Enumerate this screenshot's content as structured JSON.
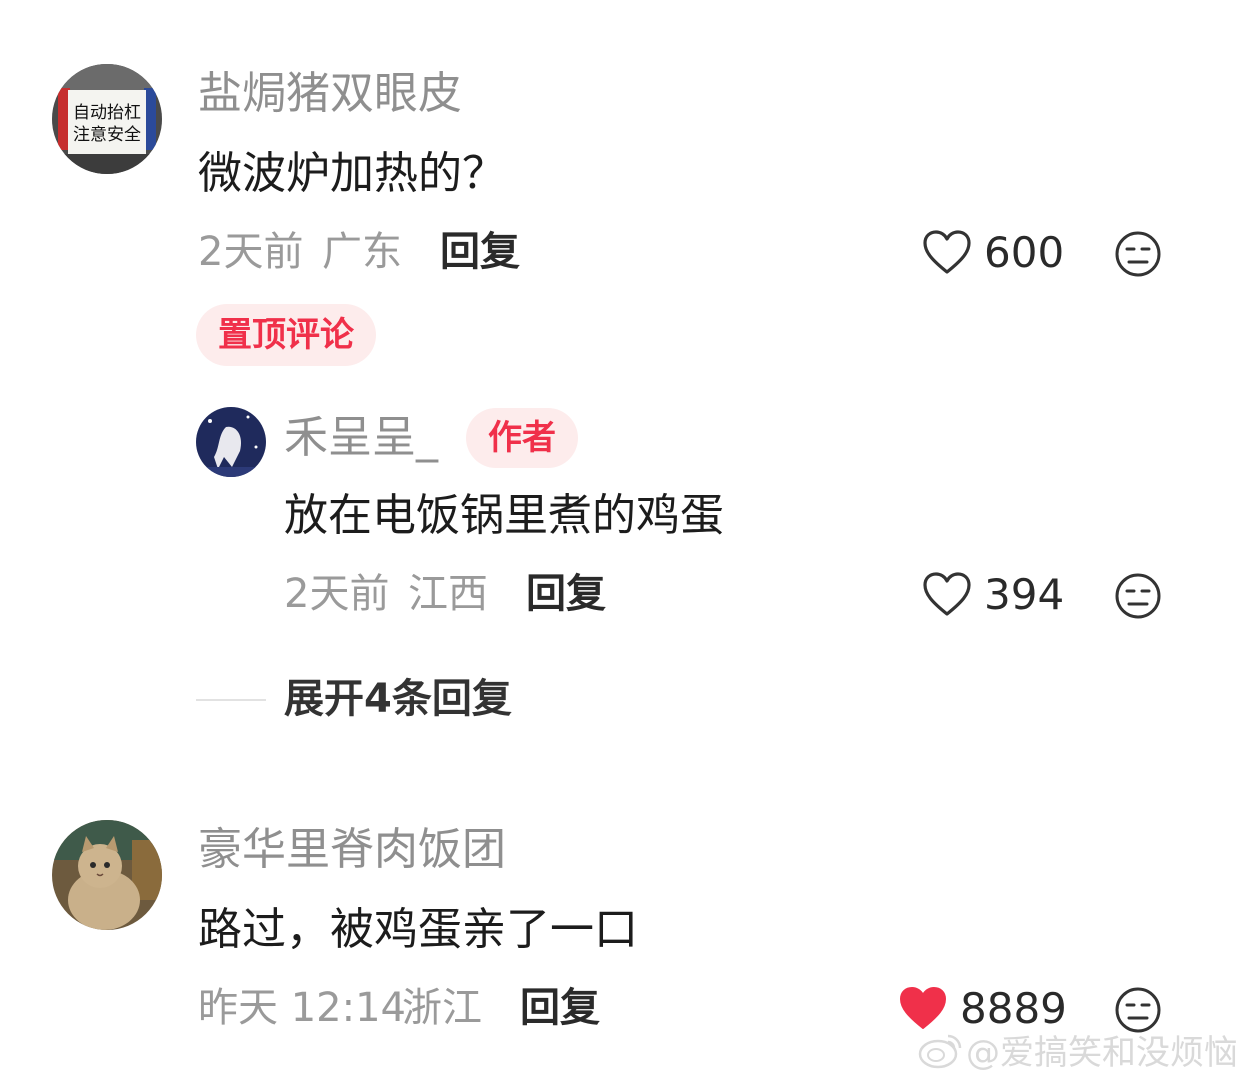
{
  "comments": [
    {
      "username": "盐焗猪双眼皮",
      "content": "微波炉加热的？",
      "time": "2天前",
      "location": "广东",
      "reply_label": "回复",
      "likes": "600",
      "liked": false,
      "pinned_label": "置顶评论",
      "avatar_text_line1": "自动抬杠",
      "avatar_text_line2": "注意安全",
      "reply": {
        "username": "禾呈呈_",
        "author_label": "作者",
        "content": "放在电饭锅里煮的鸡蛋",
        "time": "2天前",
        "location": "江西",
        "reply_label": "回复",
        "likes": "394",
        "liked": false
      },
      "expand_label": "展开4条回复"
    },
    {
      "username": "豪华里脊肉饭团",
      "content": "路过，被鸡蛋亲了一口",
      "time": "昨天 12:14",
      "location": "浙江",
      "reply_label": "回复",
      "likes": "8889",
      "liked": true
    }
  ],
  "watermark": "@爱搞笑和没烦恼",
  "colors": {
    "accent": "#f0304a",
    "like_active": "#f0304a",
    "badge_bg": "#fdecec"
  },
  "icons": [
    "heart-icon",
    "heart-filled-icon",
    "meh-emoji-icon",
    "weibo-logo-icon"
  ]
}
